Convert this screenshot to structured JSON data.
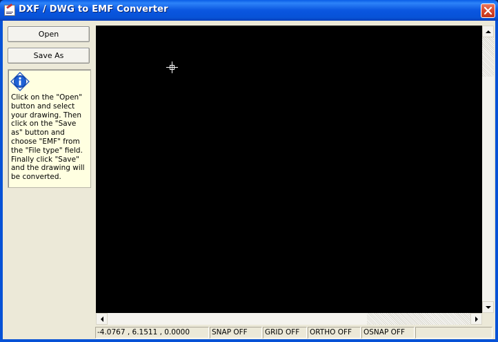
{
  "window": {
    "title": "DXF / DWG to EMF Converter",
    "accent_color": "#0a56e0",
    "app_icon": "drawing-app-icon",
    "close_icon": "close-icon"
  },
  "toolbar": {
    "open_label": "Open",
    "save_as_label": "Save As"
  },
  "info_panel": {
    "icon": "info-icon",
    "text": "Click on the \"Open\" button and select your drawing. Then click on the \"Save as\" button and choose \"EMF\" from the \"File type\" field. Finally click \"Save\" and the drawing will be converted.",
    "background": "#ffffe1"
  },
  "canvas": {
    "background": "#000000",
    "cursor_icon": "crosshair-cursor-icon"
  },
  "statusbar": {
    "coordinates": "-4.0767 , 6.1511 , 0.0000",
    "snap": "SNAP OFF",
    "grid": "GRID OFF",
    "ortho": "ORTHO OFF",
    "osnap": "OSNAP OFF",
    "extra": ""
  }
}
